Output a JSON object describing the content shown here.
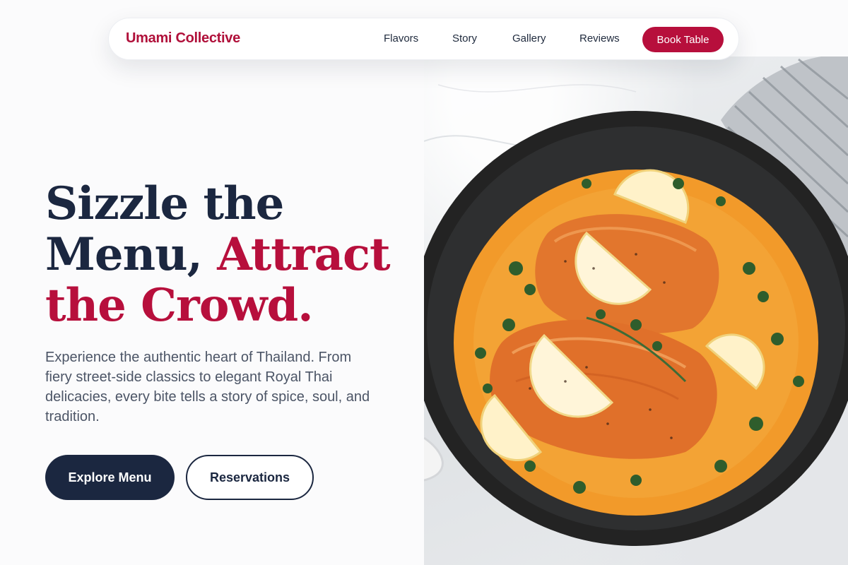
{
  "brand": {
    "name": "Umami Collective",
    "color": "#b0103a"
  },
  "nav": {
    "links": [
      {
        "label": "Flavors"
      },
      {
        "label": "Story"
      },
      {
        "label": "Gallery"
      },
      {
        "label": "Reviews"
      }
    ],
    "cta_label": "Book Table"
  },
  "hero": {
    "headline_part1": "Sizzle the Menu,",
    "headline_accent": "Attract the Crowd.",
    "lede": "Experience the authentic heart of Thailand. From fiery street-side classics to elegant Royal Thai delicacies, every bite tells a story of spice, soul, and tradition.",
    "primary_button": "Explore Menu",
    "secondary_button": "Reservations",
    "image_subject": "salmon-red-curry-pan-photo"
  },
  "colors": {
    "accent": "#b70f3c",
    "navy": "#1b2740",
    "body_text": "#4c5566",
    "curry_orange": "#f29a2a"
  }
}
